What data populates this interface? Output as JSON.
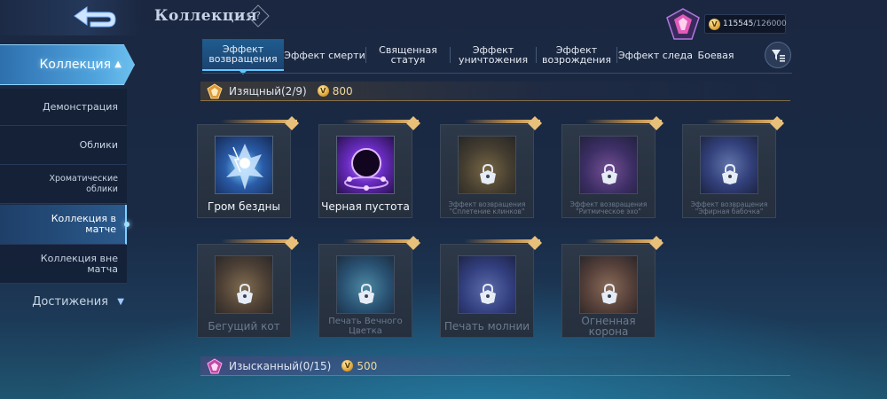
{
  "header": {
    "title": "Коллекция",
    "help": "?",
    "currency": {
      "current": "115545",
      "max": "/126000",
      "coin_symbol": "V"
    }
  },
  "sidebar": {
    "main": "Коллекция",
    "items": [
      {
        "label": "Демонстрация",
        "active": false
      },
      {
        "label": "Облики",
        "active": false
      },
      {
        "label": "Хроматические облики",
        "active": false
      },
      {
        "label": "Коллекция в матче",
        "active": true
      },
      {
        "label": "Коллекция вне матча",
        "active": false
      }
    ],
    "achievements": "Достижения"
  },
  "tabs": [
    {
      "label": "Эффект возвращения",
      "active": true
    },
    {
      "label": "Эффект смерти",
      "active": false
    },
    {
      "label": "Священная статуя",
      "active": false
    },
    {
      "label": "Эффект уничтожения",
      "active": false
    },
    {
      "label": "Эффект возрождения",
      "active": false
    },
    {
      "label": "Эффект следа",
      "active": false
    },
    {
      "label": "Боевая",
      "active": false
    }
  ],
  "sections": [
    {
      "title": "Изящный(2/9)",
      "price": "800",
      "items": [
        {
          "name": "Гром бездны",
          "locked": false,
          "icon": "thunder-abyss-art"
        },
        {
          "name": "Черная пустота",
          "locked": false,
          "icon": "black-void-art"
        },
        {
          "name": "Эффект возвращения \"Сплетение клинков\"",
          "locked": true,
          "icon": "blades-art"
        },
        {
          "name": "Эффект возвращения \"Ритмическое эхо\"",
          "locked": true,
          "icon": "rhythm-echo-art"
        },
        {
          "name": "Эффект возвращения \"Эфирная бабочка\"",
          "locked": true,
          "icon": "ether-butterfly-art"
        },
        {
          "name": "Бегущий кот",
          "locked": true,
          "icon": "running-cat-art"
        },
        {
          "name": "Печать Вечного Цветка",
          "locked": true,
          "icon": "eternal-flower-art"
        },
        {
          "name": "Печать молнии",
          "locked": true,
          "icon": "lightning-seal-art"
        },
        {
          "name": "Огненная корона",
          "locked": true,
          "icon": "fire-crown-art"
        }
      ]
    },
    {
      "title": "Изысканный(0/15)",
      "price": "500"
    }
  ],
  "colors": {
    "accent": "#5ec8ff",
    "gold": "#e8c07a",
    "background": "#1b2740"
  }
}
